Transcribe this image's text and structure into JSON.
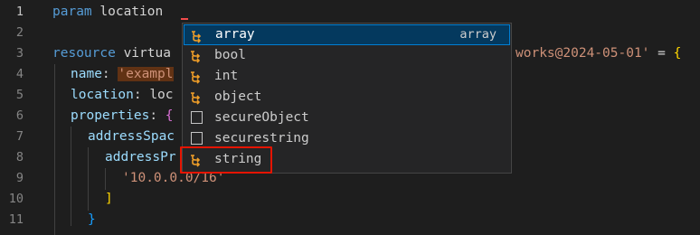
{
  "editor": {
    "line_numbers": [
      "1",
      "2",
      "3",
      "4",
      "5",
      "6",
      "7",
      "8",
      "9",
      "10",
      "11"
    ],
    "lines": {
      "l1": {
        "kw": "param",
        "rest": " location"
      },
      "l3": {
        "kw": "resource",
        "rest": " virtua",
        "tail": "works@2024-05-01'",
        "eq": " = ",
        "brace": "{"
      },
      "l4": {
        "prop": "name",
        "colon": ": ",
        "str": "'exampl"
      },
      "l5": {
        "prop": "location",
        "colon": ": ",
        "rest": "loc"
      },
      "l6": {
        "prop": "properties",
        "colon": ": ",
        "brace": "{"
      },
      "l7": {
        "prop": "addressSpac"
      },
      "l8": {
        "prop": "addressPr"
      },
      "l9": {
        "str": "'10.0.0.0/16'"
      },
      "l10": {
        "bracket": "]"
      },
      "l11": {
        "brace": "}"
      }
    }
  },
  "suggest": {
    "items": [
      {
        "label": "array",
        "detail": "array",
        "icon": "type-parameter-icon",
        "selected": true
      },
      {
        "label": "bool",
        "icon": "type-parameter-icon"
      },
      {
        "label": "int",
        "icon": "type-parameter-icon"
      },
      {
        "label": "object",
        "icon": "type-parameter-icon"
      },
      {
        "label": "secureObject",
        "icon": "snippet-box-icon"
      },
      {
        "label": "securestring",
        "icon": "snippet-box-icon"
      },
      {
        "label": "string",
        "icon": "type-parameter-icon",
        "highlighted": true
      }
    ]
  },
  "colors": {
    "background": "#1e1e1e",
    "keyword": "#569cd6",
    "property": "#9cdcfe",
    "string": "#ce9178",
    "selection": "#04395e",
    "type_icon": "#ee9d28",
    "highlight_box": "#e51400"
  }
}
